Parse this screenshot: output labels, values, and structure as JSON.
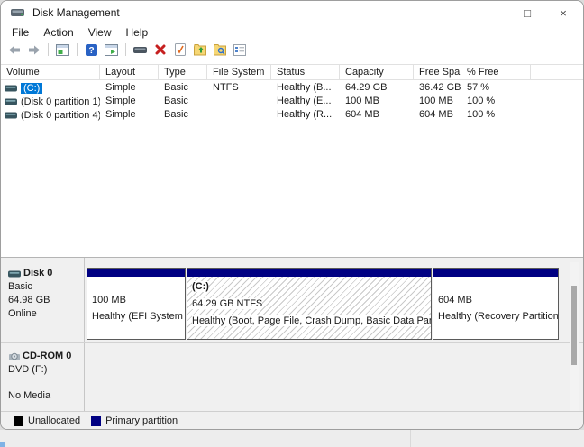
{
  "window": {
    "title": "Disk Management",
    "controls": {
      "minimize": "–",
      "maximize": "□",
      "close": "×"
    }
  },
  "menu": {
    "items": [
      {
        "label": "File"
      },
      {
        "label": "Action"
      },
      {
        "label": "View"
      },
      {
        "label": "Help"
      }
    ]
  },
  "toolbar": {
    "icons": [
      "back-icon",
      "forward-icon",
      "console-tree-icon",
      "help-icon",
      "action-pane-icon",
      "disk-icon",
      "delete-volume-icon",
      "check-document-icon",
      "folder-up-icon",
      "folder-search-icon",
      "properties-icon"
    ]
  },
  "colors": {
    "accent": "#0078d7",
    "primary_partition": "#000082",
    "unallocated": "#000000"
  },
  "volume_table": {
    "columns": [
      "Volume",
      "Layout",
      "Type",
      "File System",
      "Status",
      "Capacity",
      "Free Spa...",
      "% Free"
    ],
    "rows": [
      {
        "volume": "(C:)",
        "layout": "Simple",
        "type": "Basic",
        "file_system": "NTFS",
        "status": "Healthy (B...",
        "capacity": "64.29 GB",
        "free_space": "36.42 GB",
        "pct_free": "57 %",
        "selected": true
      },
      {
        "volume": "(Disk 0 partition 1)",
        "layout": "Simple",
        "type": "Basic",
        "file_system": "",
        "status": "Healthy (E...",
        "capacity": "100 MB",
        "free_space": "100 MB",
        "pct_free": "100 %",
        "selected": false
      },
      {
        "volume": "(Disk 0 partition 4)",
        "layout": "Simple",
        "type": "Basic",
        "file_system": "",
        "status": "Healthy (R...",
        "capacity": "604 MB",
        "free_space": "604 MB",
        "pct_free": "100 %",
        "selected": false
      }
    ]
  },
  "disk0": {
    "name": "Disk 0",
    "type": "Basic",
    "size": "64.98 GB",
    "status": "Online",
    "partitions": [
      {
        "line1": "100 MB",
        "line2": "Healthy (EFI System P"
      },
      {
        "name": "(C:)",
        "line1": "64.29 GB NTFS",
        "line2": "Healthy (Boot, Page File, Crash Dump, Basic Data Partitio",
        "selected": true
      },
      {
        "line1": "604 MB",
        "line2": "Healthy (Recovery Partition)"
      }
    ]
  },
  "cdrom": {
    "name": "CD-ROM 0",
    "drive": "DVD (F:)",
    "media": "No Media"
  },
  "legend": {
    "items": [
      {
        "label": "Unallocated",
        "color": "#000000"
      },
      {
        "label": "Primary partition",
        "color": "#000082"
      }
    ]
  }
}
